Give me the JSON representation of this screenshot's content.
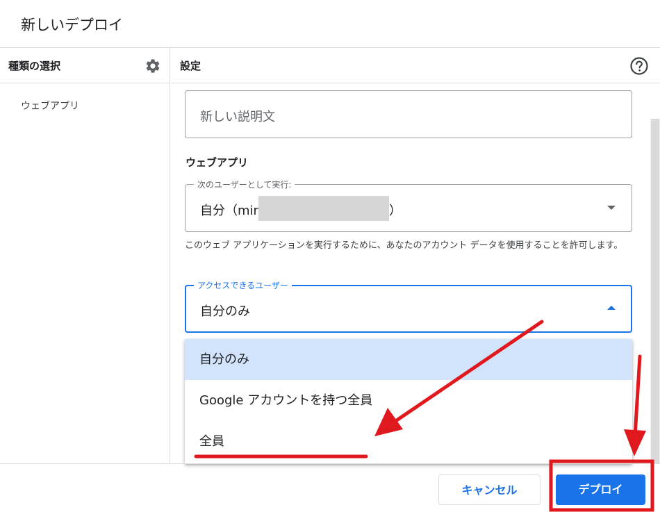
{
  "dialog": {
    "title": "新しいデプロイ"
  },
  "left": {
    "header": "種類の選択",
    "gear_icon": "gear-icon",
    "items": [
      "ウェブアプリ"
    ]
  },
  "right": {
    "header": "設定",
    "help_icon": "help-circle-icon",
    "description_placeholder": "新しい説明文",
    "section_label": "ウェブアプリ",
    "execute_as": {
      "legend": "次のユーザーとして実行:",
      "value_prefix": "自分（mir",
      "value_suffix": "）"
    },
    "help_text": "このウェブ アプリケーションを実行するために、あなたのアカウント データを使用することを許可します。",
    "access": {
      "legend": "アクセスできるユーザー",
      "value": "自分のみ"
    }
  },
  "menu": {
    "options": [
      "自分のみ",
      "Google アカウントを持つ全員",
      "全員"
    ],
    "selected_index": 0
  },
  "footer": {
    "cancel_label": "キャンセル",
    "deploy_label": "デプロイ"
  },
  "colors": {
    "accent": "#1a73e8",
    "selected_option_bg": "#d2e3fc",
    "annotation_red": "#e0191e"
  }
}
